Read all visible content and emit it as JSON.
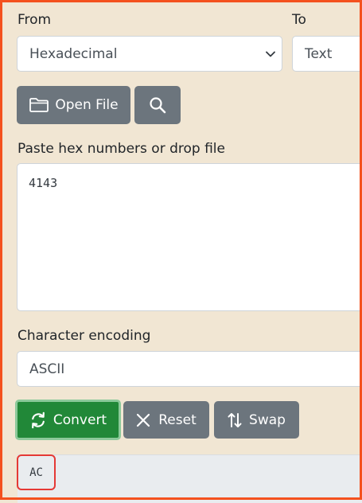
{
  "from": {
    "label": "From",
    "selected": "Hexadecimal"
  },
  "to": {
    "label": "To",
    "selected": "Text"
  },
  "file_buttons": {
    "open_file_label": "Open File",
    "search_icon": "magnifier-icon",
    "folder_icon": "folder-icon"
  },
  "input": {
    "label": "Paste hex numbers or drop file",
    "value": "4143"
  },
  "encoding": {
    "label": "Character encoding",
    "selected": "ASCII"
  },
  "actions": {
    "convert_label": "Convert",
    "reset_label": "Reset",
    "swap_label": "Swap",
    "convert_icon": "refresh-icon",
    "reset_icon": "close-icon",
    "swap_icon": "swap-arrows-icon"
  },
  "output": {
    "value": "AC"
  },
  "colors": {
    "page_background": "#f1e6d3",
    "frame_border": "#f4511e",
    "button_gray": "#6c757d",
    "button_green": "#218838",
    "output_highlight": "#e53935"
  }
}
